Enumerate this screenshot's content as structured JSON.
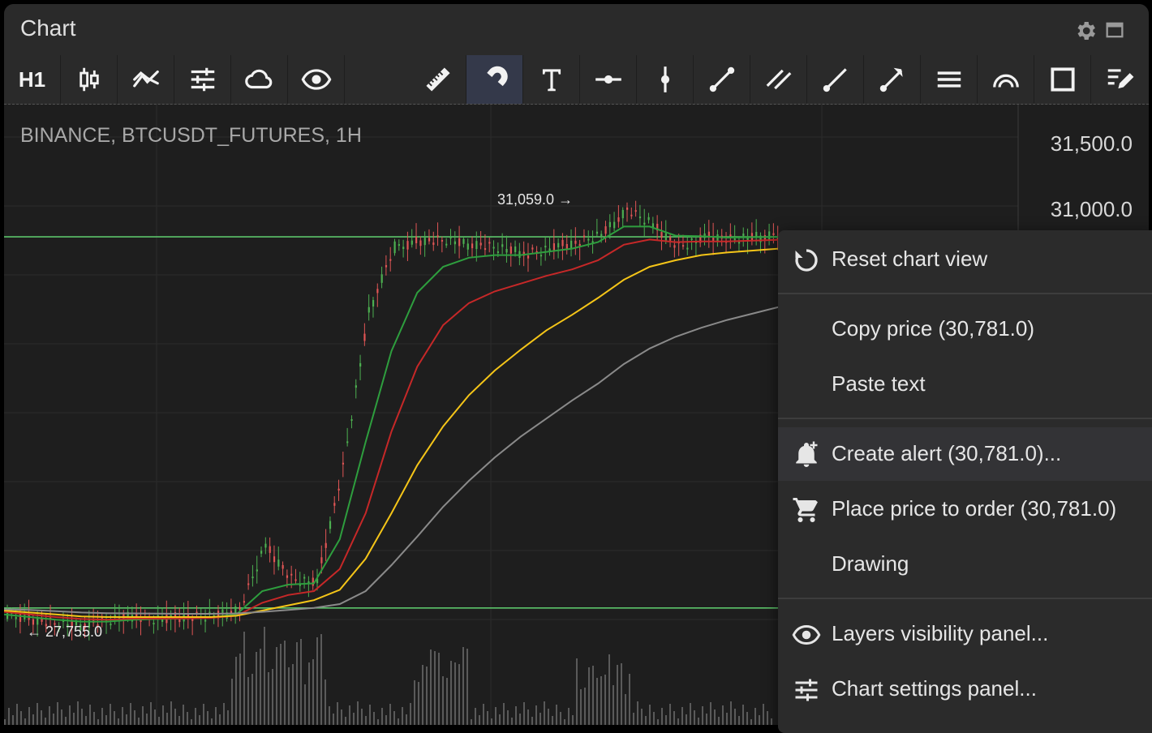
{
  "window": {
    "title": "Chart"
  },
  "toolbar": {
    "timeframe": "H1",
    "tools": [
      "candles-icon",
      "indicators-icon",
      "settings-sliders-icon",
      "cloud-icon",
      "eye-icon",
      "ruler-icon",
      "magnet-icon",
      "text-icon",
      "horizontal-ray-icon",
      "vertical-line-icon",
      "trend-line-icon",
      "parallel-channel-icon",
      "ray-icon",
      "arrow-line-icon",
      "horizontal-lines-icon",
      "arc-icon",
      "rectangle-icon",
      "drawing-list-icon"
    ],
    "active_tool": "magnet-icon"
  },
  "chart": {
    "symbol": "BINANCE, BTCUSDT_FUTURES, 1H",
    "y_labels": [
      "31,500.0",
      "31,000.0"
    ],
    "high_label": "31,059.0 →",
    "low_label": "← 27,755.0"
  },
  "chart_data": {
    "type": "line",
    "title": "",
    "symbol": "BINANCE, BTCUSDT_FUTURES, 1H",
    "y_ticks": [
      31500.0,
      31000.0
    ],
    "annotations": [
      {
        "label": "31,059.0",
        "value": 31059.0
      },
      {
        "label": "27,755.0",
        "value": 27755.0
      }
    ],
    "horizontal_lines": [
      30781.0,
      27920.0
    ],
    "series": [
      {
        "role": "price",
        "color": "#4caf50",
        "values": [
          27880,
          27830,
          27800,
          27790,
          27820,
          27860,
          27840,
          27850,
          27860,
          27900,
          28400,
          28150,
          28120,
          29000,
          30200,
          30700,
          30750,
          30760,
          30720,
          30690,
          30650,
          30700,
          30730,
          30800,
          30980,
          30870,
          30710,
          30780,
          30760,
          30780,
          30781
        ]
      },
      {
        "role": "ema-fast",
        "color": "#2e9e3e",
        "values": [
          27870,
          27850,
          27830,
          27815,
          27815,
          27830,
          27835,
          27840,
          27845,
          27870,
          28050,
          28100,
          28110,
          28450,
          29200,
          29900,
          30350,
          30550,
          30620,
          30640,
          30640,
          30665,
          30690,
          30740,
          30860,
          30860,
          30790,
          30785,
          30775,
          30778,
          30780
        ]
      },
      {
        "role": "ema-mid",
        "color": "#c62828",
        "values": [
          27890,
          27870,
          27850,
          27835,
          27830,
          27838,
          27838,
          27840,
          27843,
          27860,
          27960,
          28020,
          28050,
          28220,
          28650,
          29280,
          29780,
          30100,
          30270,
          30360,
          30420,
          30480,
          30530,
          30600,
          30720,
          30760,
          30740,
          30745,
          30745,
          30752,
          30758
        ]
      },
      {
        "role": "ema-slow",
        "color": "#f5c518",
        "values": [
          27900,
          27885,
          27870,
          27855,
          27850,
          27850,
          27850,
          27850,
          27850,
          27860,
          27900,
          27940,
          27980,
          28060,
          28300,
          28650,
          29020,
          29320,
          29560,
          29750,
          29910,
          30060,
          30180,
          30310,
          30450,
          30550,
          30600,
          30640,
          30660,
          30675,
          30690
        ]
      },
      {
        "role": "ema-long",
        "color": "#8a8a8a",
        "values": [
          27910,
          27905,
          27895,
          27885,
          27880,
          27878,
          27876,
          27875,
          27875,
          27878,
          27890,
          27905,
          27920,
          27950,
          28050,
          28250,
          28470,
          28700,
          28900,
          29080,
          29240,
          29380,
          29520,
          29650,
          29800,
          29920,
          30010,
          30080,
          30140,
          30190,
          30240
        ]
      }
    ]
  },
  "menu": {
    "items": [
      {
        "label": "Reset chart view",
        "icon": "reset-icon"
      },
      {
        "label": "Copy price (30,781.0)",
        "icon": ""
      },
      {
        "label": "Paste text",
        "icon": ""
      },
      {
        "label": "Create alert (30,781.0)...",
        "icon": "alert-bell-icon"
      },
      {
        "label": "Place price to order (30,781.0)",
        "icon": "cart-icon"
      },
      {
        "label": "Drawing",
        "icon": ""
      },
      {
        "label": "Layers visibility panel...",
        "icon": "eye-icon"
      },
      {
        "label": "Chart settings panel...",
        "icon": "settings-sliders-icon"
      }
    ]
  },
  "colors": {
    "background": "#1e1e1e",
    "panel": "#2a2a2a",
    "active_tool": "#34394a",
    "up": "#4caf50",
    "down": "#e05555"
  }
}
